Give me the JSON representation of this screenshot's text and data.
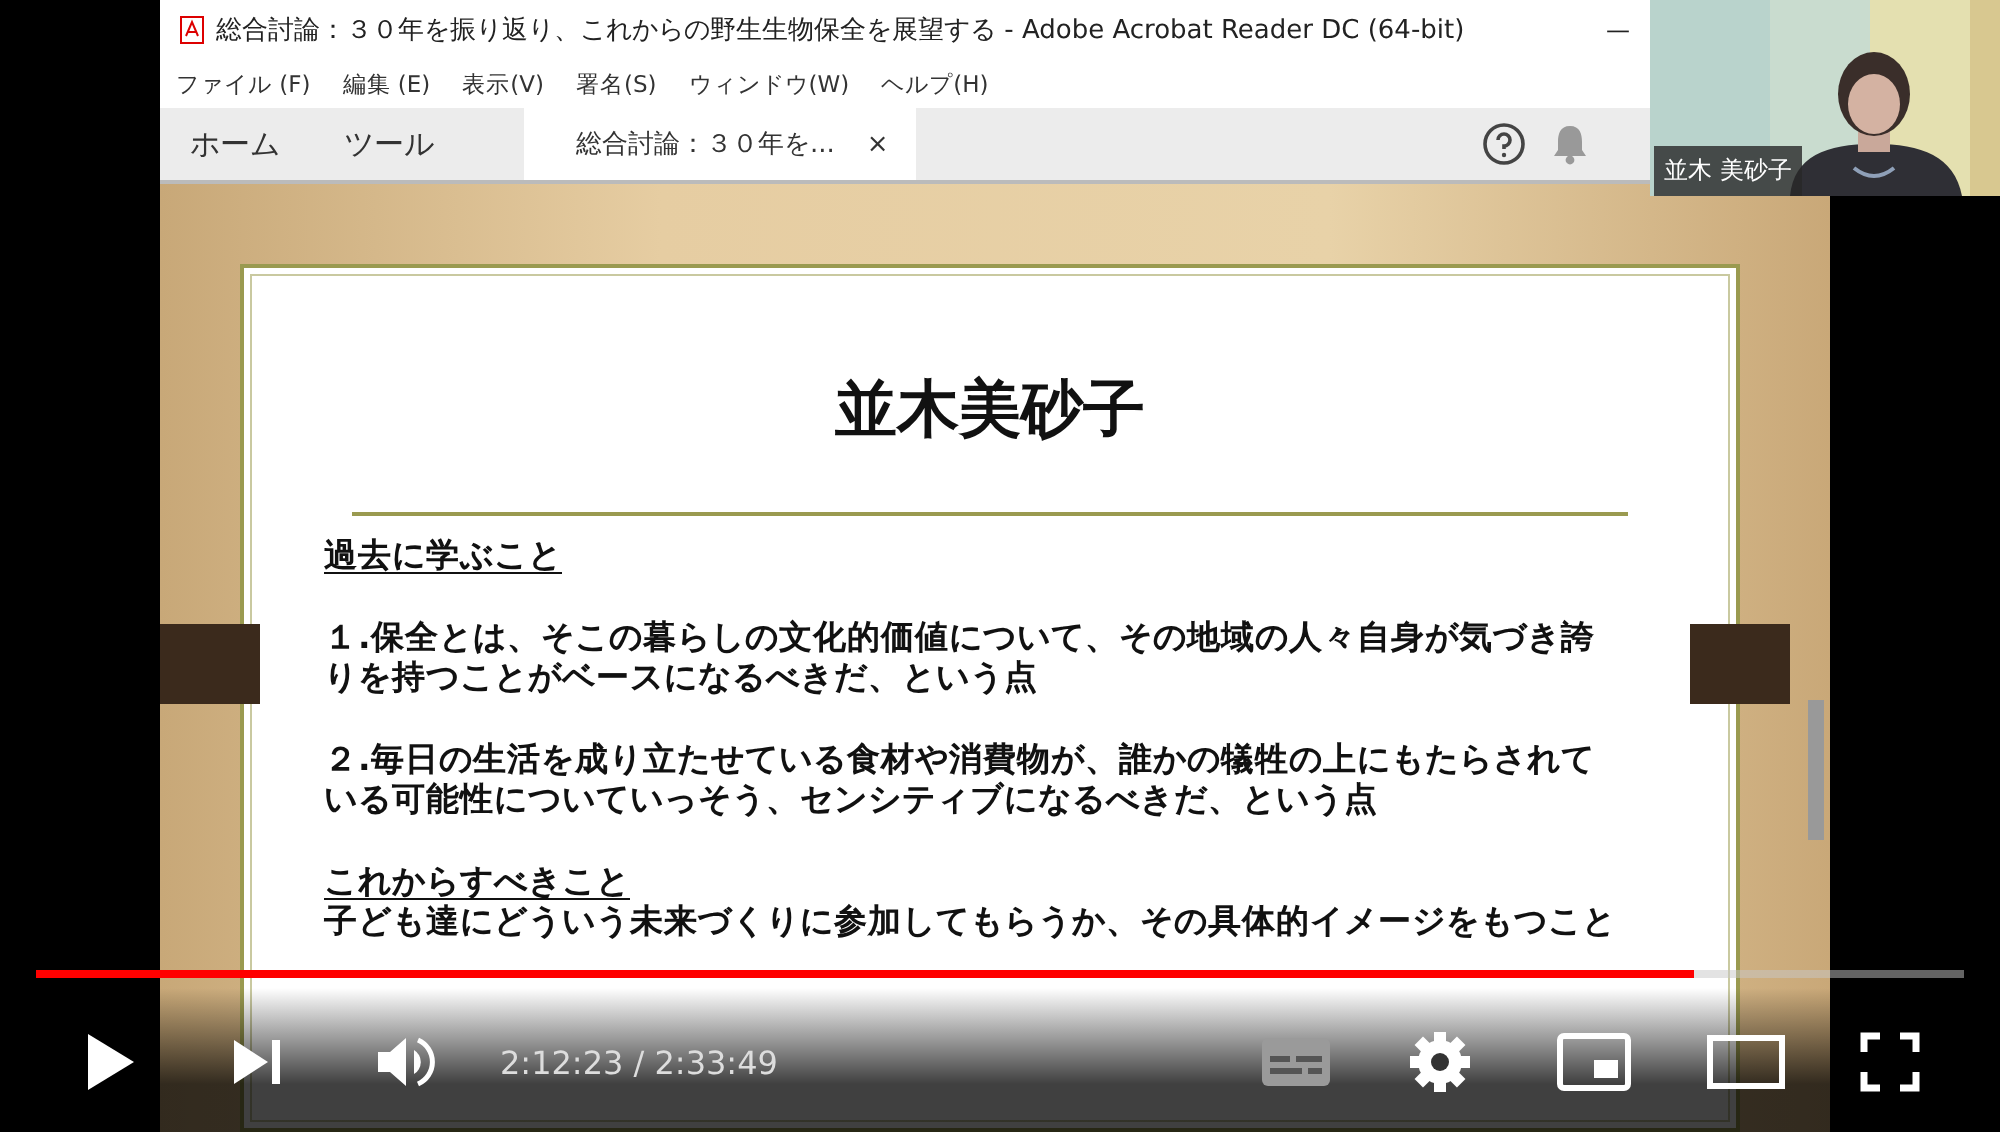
{
  "window": {
    "title": "総合討論：３０年を振り返り、これからの野生生物保全を展望する - Adobe Acrobat Reader DC (64-bit)",
    "minimize": "—"
  },
  "menu": [
    "ファイル (F)",
    "編集 (E)",
    "表示(V)",
    "署名(S)",
    "ウィンドウ(W)",
    "ヘルプ(H)"
  ],
  "tabs": [
    {
      "label": "ホーム",
      "kind": "nav"
    },
    {
      "label": "ツール",
      "kind": "nav"
    },
    {
      "label": "総合討論：３０年を...",
      "kind": "document",
      "close": "×"
    }
  ],
  "slide": {
    "title": "並木美砂子",
    "blocks": [
      {
        "kind": "heading",
        "text": "過去に学ぶこと"
      },
      {
        "kind": "paragraph",
        "text": "１.保全とは、そこの暮らしの文化的価値について、その地域の人々自身が気づき誇りを持つことがベースになるべきだ、という点"
      },
      {
        "kind": "paragraph",
        "text": "２.毎日の生活を成り立たせている食材や消費物が、誰かの犠牲の上にもたらされている可能性についていっそう、センシティブになるべきだ、という点"
      },
      {
        "kind": "heading",
        "text": "これからすべきこと"
      },
      {
        "kind": "line",
        "text": "子ども達にどういう未来づくりに参加してもらうか、その具体的イメージをもつこと"
      }
    ]
  },
  "participant": {
    "name": "並木 美砂子"
  },
  "player": {
    "progress": {
      "level": 0.86
    },
    "time": "2:12:23 / 2:33:49"
  }
}
